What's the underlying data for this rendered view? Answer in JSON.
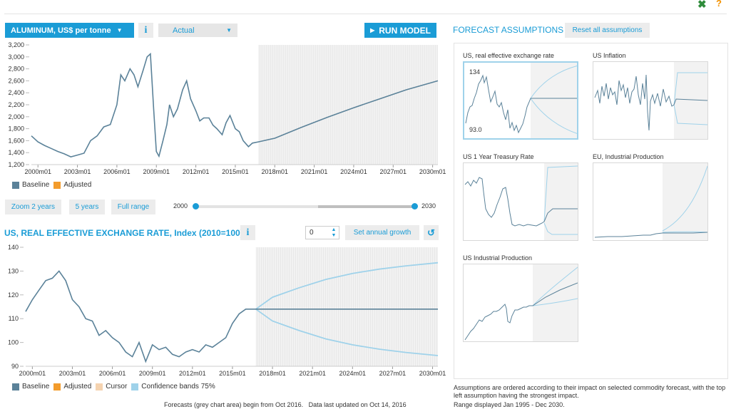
{
  "toolbar": {
    "commodity_label": "ALUMINUM, US$ per tonne",
    "info_label": "i",
    "mode_value": "Actual",
    "run_label": "RUN MODEL"
  },
  "assumptions_panel": {
    "title": "FORECAST ASSUMPTIONS",
    "reset_label": "Reset all assumptions",
    "items": [
      {
        "title": "US, real effective exchange rate",
        "max_label": "134",
        "min_label": "93.0"
      },
      {
        "title": "US Inflation"
      },
      {
        "title": "US 1 Year Treasury Rate"
      },
      {
        "title": "EU, Industrial Production"
      },
      {
        "title": "US Industrial Production"
      }
    ],
    "note": "Assumptions are ordered according to their impact on selected commodity forecast, with the top left assumption having the strongest impact.",
    "range_note": "Range displayed Jan 1995 - Dec 2030."
  },
  "range_controls": {
    "zoom2_label": "Zoom 2 years",
    "zoom5_label": "5 years",
    "full_label": "Full range",
    "start_label": "2000",
    "end_label": "2030"
  },
  "assumption_editor": {
    "title": "US, REAL EFFECTIVE EXCHANGE RATE,",
    "unit": "Index (2010=100)",
    "growth_value": "0",
    "set_growth_label": "Set annual growth",
    "reset_icon": "undo-icon"
  },
  "legend1": {
    "baseline": "Baseline",
    "adjusted": "Adjusted"
  },
  "legend2": {
    "baseline": "Baseline",
    "adjusted": "Adjusted",
    "cursor": "Cursor",
    "bands": "Confidence bands 75%"
  },
  "footer": "Forecasts (grey chart area) begin from Oct 2016.   Data last updated on Oct 14, 2016",
  "colors": {
    "accent": "#1a9cd6",
    "baseline": "#5b8299",
    "adjusted": "#f39c2c",
    "cursor": "#f5d3b0",
    "bands": "#9fd2ea",
    "forecast_area": "#f2f2f2"
  },
  "chart_data": [
    {
      "type": "line",
      "title": "ALUMINUM, US$ per tonne",
      "x_ticks": [
        "2000m01",
        "2003m01",
        "2006m01",
        "2009m01",
        "2012m01",
        "2015m01",
        "2018m01",
        "2021m01",
        "2024m01",
        "2027m01",
        "2030m01"
      ],
      "y_ticks": [
        1200,
        1400,
        1600,
        1800,
        2000,
        2200,
        2400,
        2600,
        2800,
        3000,
        3200
      ],
      "ylim": [
        1200,
        3200
      ],
      "xlim": [
        1999.5,
        2030.4
      ],
      "forecast_start": 2016.75,
      "series": [
        {
          "name": "Baseline",
          "x": [
            1999.5,
            2000.0,
            2000.5,
            2001.0,
            2001.5,
            2002.0,
            2002.5,
            2003.0,
            2003.5,
            2004.0,
            2004.5,
            2005.0,
            2005.5,
            2006.0,
            2006.3,
            2006.6,
            2007.0,
            2007.3,
            2007.6,
            2008.0,
            2008.3,
            2008.55,
            2008.8,
            2009.0,
            2009.2,
            2009.5,
            2009.8,
            2010.0,
            2010.3,
            2010.6,
            2011.0,
            2011.3,
            2011.6,
            2012.0,
            2012.3,
            2012.6,
            2013.0,
            2013.3,
            2013.6,
            2014.0,
            2014.3,
            2014.6,
            2015.0,
            2015.3,
            2015.6,
            2016.0,
            2016.3,
            2016.75,
            2018.0,
            2020.0,
            2022.0,
            2024.0,
            2026.0,
            2028.0,
            2030.4
          ],
          "values": [
            1680,
            1580,
            1520,
            1470,
            1420,
            1380,
            1330,
            1360,
            1390,
            1600,
            1680,
            1830,
            1870,
            2200,
            2700,
            2600,
            2800,
            2700,
            2500,
            2780,
            3000,
            3050,
            2100,
            1420,
            1340,
            1600,
            1870,
            2200,
            2000,
            2130,
            2450,
            2600,
            2300,
            2100,
            1930,
            1980,
            1980,
            1860,
            1800,
            1700,
            1900,
            2020,
            1800,
            1750,
            1600,
            1500,
            1560,
            1580,
            1640,
            1820,
            1990,
            2150,
            2300,
            2450,
            2600
          ]
        }
      ]
    },
    {
      "type": "line",
      "title": "US, REAL EFFECTIVE EXCHANGE RATE, Index (2010=100)",
      "x_ticks": [
        "2000m01",
        "2003m01",
        "2006m01",
        "2009m01",
        "2012m01",
        "2015m01",
        "2018m01",
        "2021m01",
        "2024m01",
        "2027m01",
        "2030m01"
      ],
      "y_ticks": [
        90,
        100,
        110,
        120,
        130,
        140
      ],
      "ylim": [
        90,
        140
      ],
      "xlim": [
        1999.5,
        2030.4
      ],
      "forecast_start": 2016.75,
      "series": [
        {
          "name": "Baseline",
          "x": [
            1999.5,
            2000.0,
            2000.5,
            2001.0,
            2001.5,
            2002.0,
            2002.5,
            2003.0,
            2003.5,
            2004.0,
            2004.5,
            2005.0,
            2005.5,
            2006.0,
            2006.5,
            2007.0,
            2007.5,
            2008.0,
            2008.5,
            2009.0,
            2009.5,
            2010.0,
            2010.5,
            2011.0,
            2011.5,
            2012.0,
            2012.5,
            2013.0,
            2013.5,
            2014.0,
            2014.5,
            2015.0,
            2015.5,
            2016.0,
            2016.75,
            2030.4
          ],
          "values": [
            113,
            118,
            122,
            126,
            127,
            130,
            126,
            118,
            115,
            110,
            109,
            103,
            105,
            102,
            100,
            96,
            94,
            100,
            92,
            99,
            97,
            98,
            95,
            94,
            96,
            97,
            96,
            99,
            98,
            100,
            102,
            108,
            112,
            114,
            114,
            114
          ]
        },
        {
          "name": "Confidence bands 75%",
          "x": [
            2016.75,
            2018.0,
            2020.0,
            2022.0,
            2024.0,
            2026.0,
            2028.0,
            2030.4
          ],
          "upper": [
            114,
            119,
            123,
            126.5,
            129,
            130.8,
            132.2,
            133.5
          ],
          "lower": [
            114,
            109,
            105,
            101.5,
            99,
            97.2,
            95.8,
            94.5
          ]
        }
      ]
    }
  ]
}
